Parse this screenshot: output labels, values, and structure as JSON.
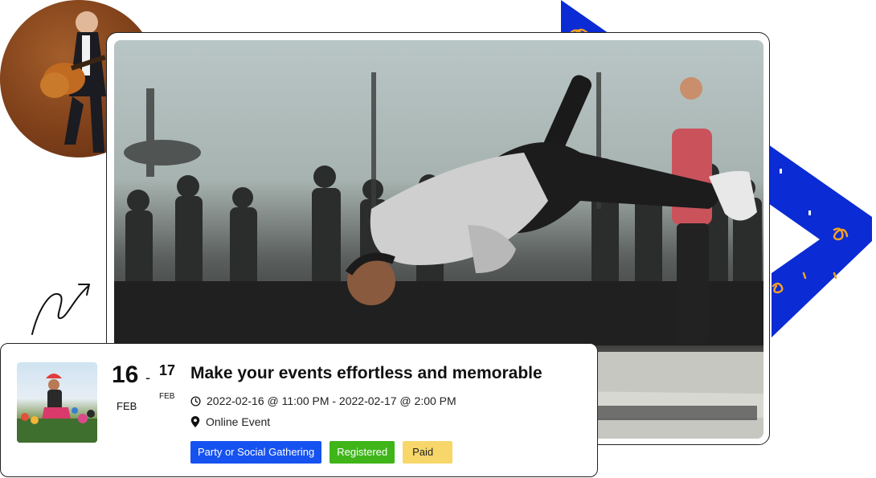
{
  "event": {
    "start_day": "16",
    "start_month": "FEB",
    "separator": "-",
    "end_day": "17",
    "end_month": "FEB",
    "title": "Make your events effortless and memorable",
    "datetime": "2022-02-16 @ 11:00 PM - 2022-02-17 @ 2:00 PM",
    "location": "Online Event",
    "tags": [
      "Party or Social Gathering",
      "Registered",
      "Paid"
    ]
  },
  "icons": {
    "datetime_icon": "clock-icon",
    "location_icon": "map-pin-icon",
    "doodle": "curly-arrow-icon"
  },
  "colors": {
    "brand_blue": "#1652f0",
    "chevron_blue": "#0b2bd4",
    "registered_green": "#3fb51a",
    "paid_yellow": "#f7d76a",
    "confetti_orange": "#f3a024"
  }
}
